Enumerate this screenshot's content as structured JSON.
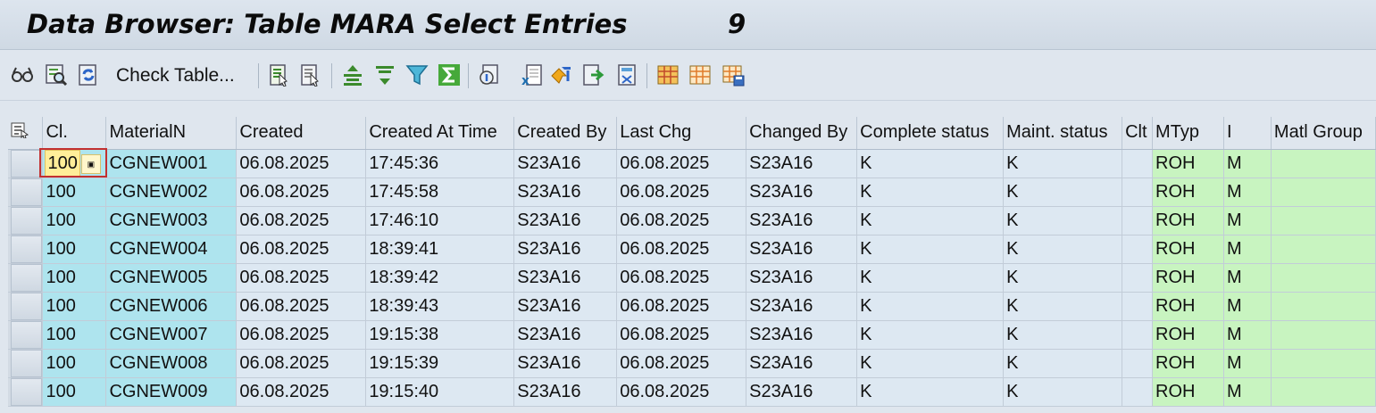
{
  "window": {
    "title": "Data Browser: Table MARA Select Entries",
    "entry_count": "9"
  },
  "toolbar": {
    "check_table_label": "Check Table...",
    "icons": [
      "display-glasses-icon",
      "detail-search-icon",
      "refresh-icon",
      "select-list-icon",
      "deselect-list-icon",
      "sort-ascending-icon",
      "sort-descending-icon",
      "filter-icon",
      "total-sum-icon",
      "details-icon",
      "export-excel-icon",
      "upload-icon",
      "download-icon",
      "print-icon",
      "layout-grid-icon",
      "layout-change-icon",
      "layout-save-icon"
    ]
  },
  "table": {
    "columns": [
      "Cl.",
      "MaterialN",
      "Created",
      "Created At Time",
      "Created By",
      "Last Chg",
      "Changed By",
      "Complete status",
      "Maint. status",
      "Clt",
      "MTyp",
      "I",
      "Matl Group"
    ],
    "rows": [
      [
        "100",
        "CGNEW001",
        "06.08.2025",
        "17:45:36",
        "S23A16",
        "06.08.2025",
        "S23A16",
        "K",
        "K",
        "",
        "ROH",
        "M",
        ""
      ],
      [
        "100",
        "CGNEW002",
        "06.08.2025",
        "17:45:58",
        "S23A16",
        "06.08.2025",
        "S23A16",
        "K",
        "K",
        "",
        "ROH",
        "M",
        ""
      ],
      [
        "100",
        "CGNEW003",
        "06.08.2025",
        "17:46:10",
        "S23A16",
        "06.08.2025",
        "S23A16",
        "K",
        "K",
        "",
        "ROH",
        "M",
        ""
      ],
      [
        "100",
        "CGNEW004",
        "06.08.2025",
        "18:39:41",
        "S23A16",
        "06.08.2025",
        "S23A16",
        "K",
        "K",
        "",
        "ROH",
        "M",
        ""
      ],
      [
        "100",
        "CGNEW005",
        "06.08.2025",
        "18:39:42",
        "S23A16",
        "06.08.2025",
        "S23A16",
        "K",
        "K",
        "",
        "ROH",
        "M",
        ""
      ],
      [
        "100",
        "CGNEW006",
        "06.08.2025",
        "18:39:43",
        "S23A16",
        "06.08.2025",
        "S23A16",
        "K",
        "K",
        "",
        "ROH",
        "M",
        ""
      ],
      [
        "100",
        "CGNEW007",
        "06.08.2025",
        "19:15:38",
        "S23A16",
        "06.08.2025",
        "S23A16",
        "K",
        "K",
        "",
        "ROH",
        "M",
        ""
      ],
      [
        "100",
        "CGNEW008",
        "06.08.2025",
        "19:15:39",
        "S23A16",
        "06.08.2025",
        "S23A16",
        "K",
        "K",
        "",
        "ROH",
        "M",
        ""
      ],
      [
        "100",
        "CGNEW009",
        "06.08.2025",
        "19:15:40",
        "S23A16",
        "06.08.2025",
        "S23A16",
        "K",
        "K",
        "",
        "ROH",
        "M",
        ""
      ]
    ]
  },
  "colors": {
    "key_column": "#aee4ee",
    "normal_cell": "#dde8f2",
    "highlight_column": "#c8f4c0",
    "focused_cell": "#ffee99"
  }
}
